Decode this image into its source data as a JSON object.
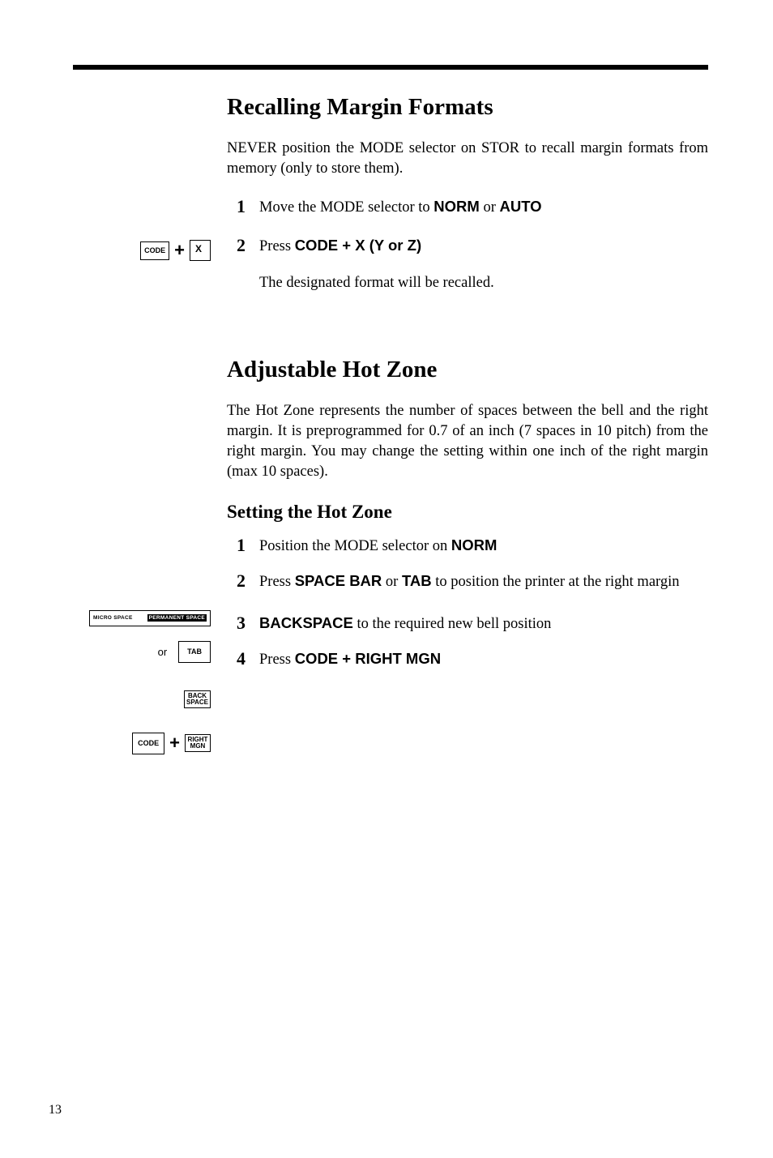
{
  "page_number": "13",
  "section1": {
    "title": "Recalling Margin Formats",
    "intro": "NEVER position the MODE selector on STOR to recall margin formats from memory (only to store them).",
    "step1_num": "1",
    "step1_pre": "Move the MODE selector to ",
    "step1_bold1": "NORM",
    "step1_mid": " or ",
    "step1_bold2": "AUTO",
    "step2_num": "2",
    "step2_pre": "Press ",
    "step2_bold": "CODE + X (Y or Z)",
    "step2_sub": "The designated format will be recalled.",
    "key_code": "CODE",
    "key_x": "X"
  },
  "section2": {
    "title": "Adjustable Hot Zone",
    "intro": "The Hot Zone represents the number of spaces between the bell and the right margin. It is preprogrammed for 0.7 of an inch (7 spaces in 10 pitch) from the right margin. You may change the setting within one inch of the right margin (max 10 spaces).",
    "subtitle": "Setting the Hot Zone",
    "step1_num": "1",
    "step1_pre": "Position the MODE selector on ",
    "step1_bold": "NORM",
    "step2_num": "2",
    "step2_pre": "Press ",
    "step2_bold1": "SPACE BAR",
    "step2_mid": " or ",
    "step2_bold2": "TAB",
    "step2_post": " to position the printer at the right margin",
    "step3_num": "3",
    "step3_bold": "BACKSPACE",
    "step3_post": " to the required new bell position",
    "step4_num": "4",
    "step4_pre": "Press ",
    "step4_bold": "CODE + RIGHT MGN",
    "spacebar_left": "MICRO SPACE",
    "spacebar_right": "PERMANENT SPACE",
    "or_label": "or",
    "key_tab": "TAB",
    "key_back_line1": "BACK",
    "key_back_line2": "SPACE",
    "key_code": "CODE",
    "key_rmgn_line1": "RIGHT",
    "key_rmgn_line2": "MGN"
  }
}
